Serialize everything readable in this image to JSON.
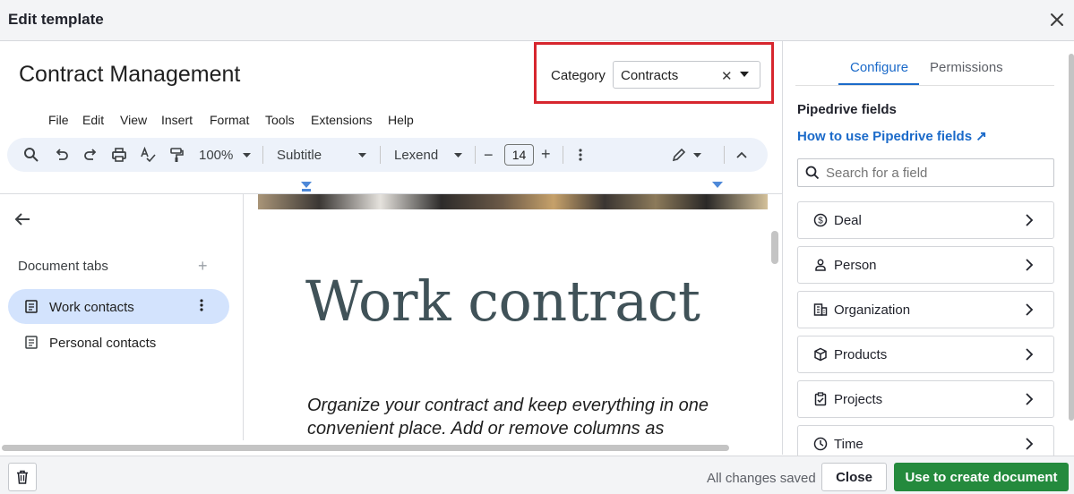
{
  "modal": {
    "title": "Edit template",
    "close_icon": "close-icon"
  },
  "document": {
    "title": "Contract Management",
    "heading": "Work contract",
    "paragraph": "Organize your contract and keep everything in one convenient place. Add or remove columns as"
  },
  "category": {
    "label": "Category",
    "value": "Contracts"
  },
  "menu": [
    "File",
    "Edit",
    "View",
    "Insert",
    "Format",
    "Tools",
    "Extensions",
    "Help"
  ],
  "toolbar": {
    "zoom": "100%",
    "style": "Subtitle",
    "font": "Lexend",
    "font_size": "14",
    "minus": "−",
    "plus": "+"
  },
  "doc_tabs": {
    "label": "Document tabs",
    "add": "+",
    "items": [
      {
        "label": "Work contacts",
        "active": true
      },
      {
        "label": "Personal contacts",
        "active": false
      }
    ]
  },
  "right_panel": {
    "tabs": [
      {
        "label": "Configure",
        "active": true
      },
      {
        "label": "Permissions",
        "active": false
      }
    ],
    "heading": "Pipedrive fields",
    "help_link": "How to use Pipedrive fields ↗",
    "search_placeholder": "Search for a field",
    "fields": [
      {
        "label": "Deal",
        "icon": "dollar-icon"
      },
      {
        "label": "Person",
        "icon": "person-icon"
      },
      {
        "label": "Organization",
        "icon": "building-icon"
      },
      {
        "label": "Products",
        "icon": "box-icon"
      },
      {
        "label": "Projects",
        "icon": "clipboard-icon"
      },
      {
        "label": "Time",
        "icon": "clock-icon"
      }
    ]
  },
  "footer": {
    "status": "All changes saved",
    "close": "Close",
    "primary": "Use to create document"
  },
  "colors": {
    "accent": "#1b6ac9",
    "primary_button": "#248a3d",
    "highlight_border": "#d7262e"
  }
}
